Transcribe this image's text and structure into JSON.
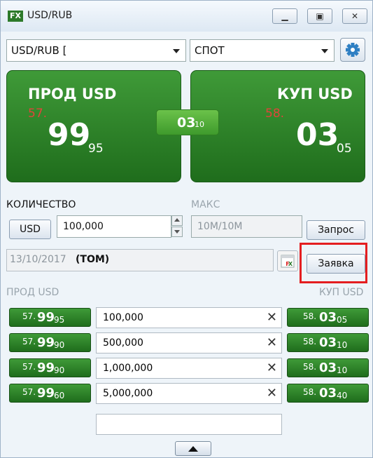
{
  "window": {
    "logo": "FX",
    "title": "USD/RUB",
    "controls": [
      "minimize-icon",
      "maximize-icon",
      "close-icon"
    ]
  },
  "instrument_select": {
    "value": "USD/RUB [     "
  },
  "type_select": {
    "value": "СПОТ"
  },
  "sell": {
    "label": "ПРОД USD",
    "prefix": "57.",
    "main": "99",
    "sub": "95"
  },
  "buy": {
    "label": "КУП USD",
    "prefix": "58.",
    "main": "03",
    "sub": "05"
  },
  "spread": {
    "main": "03",
    "sub": "10"
  },
  "quantity": {
    "label": "КОЛИЧЕСТВО",
    "currency_btn": "USD",
    "value": "100,000"
  },
  "max": {
    "label": "МАКС",
    "value": "10M/10M"
  },
  "request_btn": "Запрос",
  "order_btn": "Заявка",
  "date": {
    "value": "13/10/2017",
    "tenor": "(TOM)"
  },
  "ladder": {
    "sell_header": "ПРОД USD",
    "buy_header": "КУП USD",
    "rows": [
      {
        "sell_pre": "57.",
        "sell_main": "99",
        "sell_sub": "95",
        "qty": "100,000",
        "buy_pre": "58.",
        "buy_main": "03",
        "buy_sub": "05"
      },
      {
        "sell_pre": "57.",
        "sell_main": "99",
        "sell_sub": "90",
        "qty": "500,000",
        "buy_pre": "58.",
        "buy_main": "03",
        "buy_sub": "10"
      },
      {
        "sell_pre": "57.",
        "sell_main": "99",
        "sell_sub": "90",
        "qty": "1,000,000",
        "buy_pre": "58.",
        "buy_main": "03",
        "buy_sub": "10"
      },
      {
        "sell_pre": "57.",
        "sell_main": "99",
        "sell_sub": "60",
        "qty": "5,000,000",
        "buy_pre": "58.",
        "buy_main": "03",
        "buy_sub": "40"
      }
    ],
    "clear_glyph": "✕"
  },
  "colors": {
    "green_dark": "#1f6d1c",
    "green_light": "#3f9a38",
    "red_price": "#e0443a",
    "highlight": "#e41e20"
  }
}
